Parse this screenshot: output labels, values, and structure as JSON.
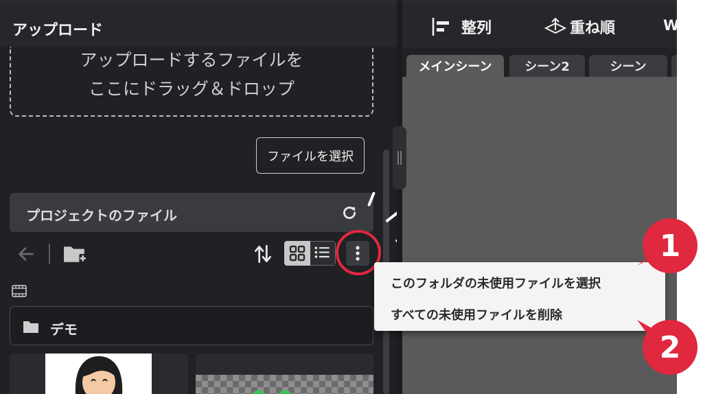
{
  "upload": {
    "title": "アップロード",
    "drop_line1": "アップロードするファイルを",
    "drop_line2": "ここにドラッグ＆ドロップ",
    "select_button": "ファイルを選択"
  },
  "project": {
    "title": "プロジェクトのファイル",
    "folder_name": "デモ"
  },
  "toolbar": {
    "align_label": "整列",
    "order_label": "重ね順",
    "truncated_label": "W"
  },
  "tabs": [
    {
      "label": "メインシーン",
      "active": true
    },
    {
      "label": "シーン2",
      "active": false
    },
    {
      "label": "シーン",
      "active": false
    }
  ],
  "menu": {
    "items": [
      "このフォルダの未使用ファイルを選択",
      "すべての未使用ファイルを削除"
    ]
  },
  "annotations": {
    "badge1": "1",
    "badge2": "2",
    "accent_color": "#e0283e"
  },
  "icons": [
    "refresh-icon",
    "back-arrow-icon",
    "new-folder-icon",
    "sort-icon",
    "grid-view-icon",
    "list-view-icon",
    "more-vertical-icon",
    "film-icon",
    "folder-icon",
    "align-icon",
    "layer-order-icon"
  ]
}
